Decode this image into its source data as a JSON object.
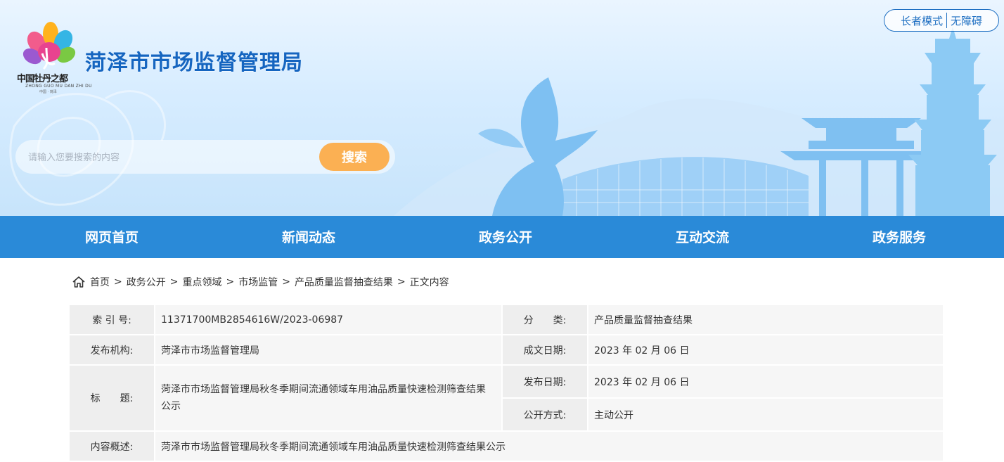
{
  "header": {
    "site_title": "菏泽市市场监督管理局",
    "logo_text": "中国牡丹之都",
    "logo_sub": "ZHONG GUO MU DAN ZHI DU",
    "logo_sub2": "中国 · 菏泽",
    "tools": {
      "elder_mode": "长者模式",
      "accessibility": "无障碍"
    },
    "search": {
      "placeholder": "请输入您要搜索的内容",
      "button_label": "搜索"
    }
  },
  "nav": {
    "items": [
      {
        "label": "网页首页"
      },
      {
        "label": "新闻动态"
      },
      {
        "label": "政务公开"
      },
      {
        "label": "互动交流"
      },
      {
        "label": "政务服务"
      }
    ]
  },
  "breadcrumb": {
    "separator": ">",
    "items": [
      "首页",
      "政务公开",
      "重点领域",
      "市场监管",
      "产品质量监督抽查结果",
      "正文内容"
    ]
  },
  "info_table": {
    "index_label": "索 引 号:",
    "index_value": "11371700MB2854616W/2023-06987",
    "category_label": "分　　类:",
    "category_value": "产品质量监督抽查结果",
    "publisher_label": "发布机构:",
    "publisher_value": "菏泽市市场监督管理局",
    "created_label": "成文日期:",
    "created_value": "2023 年 02 月 06 日",
    "title_label": "标　　题:",
    "title_value": "菏泽市市场监督管理局秋冬季期间流通领域车用油品质量快速检测筛查结果公示",
    "published_label": "发布日期:",
    "published_value": "2023 年 02 月 06 日",
    "open_mode_label": "公开方式:",
    "open_mode_value": "主动公开",
    "summary_label": "内容概述:",
    "summary_value": "菏泽市市场监督管理局秋冬季期间流通领域车用油品质量快速检测筛查结果公示"
  },
  "colors": {
    "nav_bg": "#2a8ad8",
    "title_blue": "#1565c0",
    "search_button": "#fbb053",
    "table_label_bg": "#eeeeee",
    "table_value_bg": "#f6f6f6"
  },
  "icons": [
    "peony-logo-icon",
    "home-icon"
  ]
}
